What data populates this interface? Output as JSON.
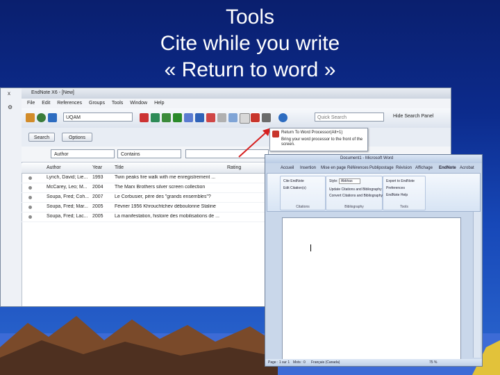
{
  "slide": {
    "title_lines": [
      "Tools",
      "Cite while you write",
      "« Return to word »"
    ]
  },
  "endnote": {
    "window_title": "EndNote X6 - [New]",
    "menu": [
      "File",
      "Edit",
      "References",
      "Groups",
      "Tools",
      "Window",
      "Help"
    ],
    "library_select": "UQAM",
    "quick_search_placeholder": "Quick Search",
    "hide_search_panel": "Hide Search Panel",
    "search_button": "Search",
    "options_button": "Options",
    "field_select": "Author",
    "operator_select": "Contains",
    "columns": {
      "author": "Author",
      "year": "Year",
      "title": "Title",
      "rating": "Rating"
    },
    "rows": [
      {
        "author": "Lynch, David; Lie...",
        "year": "1993",
        "title": "Twin peaks fire walk with me enregistrement ..."
      },
      {
        "author": "McCarey, Leo; M...",
        "year": "2004",
        "title": "The Marx Brothers silver screen collection"
      },
      {
        "author": "Soupa, Fred; Coh...",
        "year": "2007",
        "title": "Le Corbusier, père des \"grands ensembles\"?"
      },
      {
        "author": "Soupa, Fred; Mar...",
        "year": "2005",
        "title": "Février 1956 Khrouchtchev déboulonne Staline"
      },
      {
        "author": "Soupa, Fred; Lac...",
        "year": "2005",
        "title": "La manifestation, histoire des mobilisations de ..."
      }
    ]
  },
  "tooltip": {
    "title": "Return To Word Processor(Alt+1)",
    "body": "Bring your word processor to the front of the screen."
  },
  "word": {
    "window_title": "Document1 - Microsoft Word",
    "tabs": [
      "Accueil",
      "Insertion",
      "Mise en page",
      "Références",
      "Publipostage",
      "Révision",
      "Affichage",
      "EndNote",
      "Acrobat"
    ],
    "group1_lines": [
      "Cite EndNote",
      "Edit Citation(s)"
    ],
    "group1_label": "Citations",
    "style_label": "Style:",
    "style_value": "Abkhas",
    "group2_lines": [
      "Update Citations and Bibliography",
      "Convert Citations and Bibliography"
    ],
    "group2_label": "Bibliography",
    "group3_lines": [
      "Export to EndNote",
      "Preferences",
      "EndNote Help"
    ],
    "group3_label": "Tools",
    "status": [
      "Page : 1 sur 1",
      "Mots : 0",
      "Français (Canada)",
      "75 %"
    ]
  },
  "colors": {
    "accent_red": "#c8352c",
    "slide_blue": "#0c2b8c"
  }
}
